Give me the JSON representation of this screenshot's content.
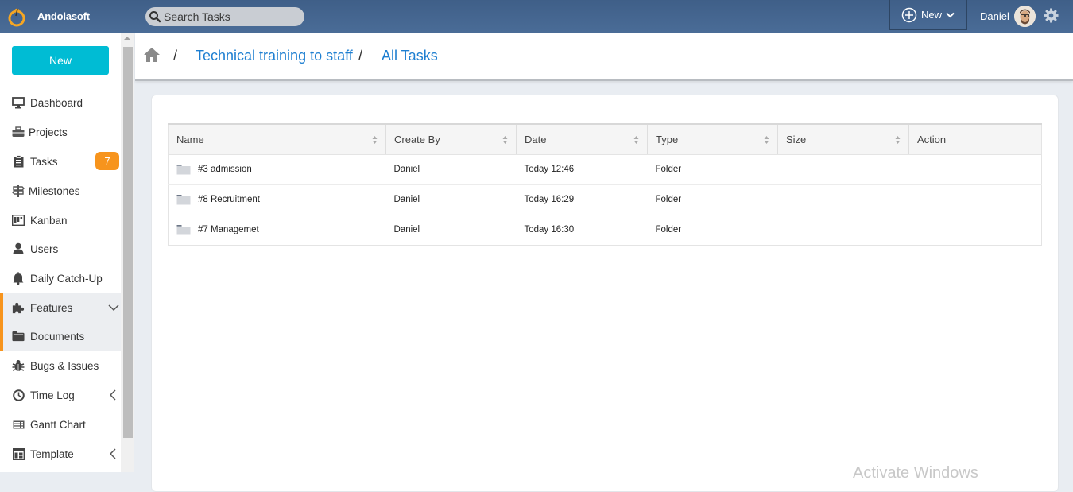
{
  "topbar": {
    "brand": "Andolasoft",
    "search_placeholder": "Search Tasks",
    "new_label": "New",
    "user_name": "Daniel"
  },
  "sidebar": {
    "new_button": "New",
    "items": [
      {
        "label": "Dashboard",
        "icon": "monitor-icon"
      },
      {
        "label": "Projects",
        "icon": "briefcase-icon"
      },
      {
        "label": "Tasks",
        "icon": "clipboard-icon",
        "badge": "7"
      },
      {
        "label": "Milestones",
        "icon": "signpost-icon"
      },
      {
        "label": "Kanban",
        "icon": "kanban-icon"
      },
      {
        "label": "Users",
        "icon": "user-icon"
      },
      {
        "label": "Daily Catch-Up",
        "icon": "bell-icon"
      },
      {
        "label": "Features",
        "icon": "puzzle-icon",
        "expanded": true
      },
      {
        "label": "Documents",
        "icon": "folder-icon",
        "active": true
      },
      {
        "label": "Bugs & Issues",
        "icon": "bug-icon"
      },
      {
        "label": "Time Log",
        "icon": "clock-icon"
      },
      {
        "label": "Gantt Chart",
        "icon": "gantt-icon"
      },
      {
        "label": "Template",
        "icon": "template-icon"
      }
    ]
  },
  "breadcrumb": {
    "separator": "/",
    "items": [
      "Technical training to staff",
      "All Tasks"
    ]
  },
  "table": {
    "columns": [
      "Name",
      "Create By",
      "Date",
      "Type",
      "Size",
      "Action"
    ],
    "rows": [
      {
        "name": "#3 admission",
        "created_by": "Daniel",
        "date": "Today 12:46",
        "type": "Folder",
        "size": "",
        "action": ""
      },
      {
        "name": "#8 Recruitment",
        "created_by": "Daniel",
        "date": "Today 16:29",
        "type": "Folder",
        "size": "",
        "action": ""
      },
      {
        "name": "#7 Managemet",
        "created_by": "Daniel",
        "date": "Today 16:30",
        "type": "Folder",
        "size": "",
        "action": ""
      }
    ]
  },
  "colors": {
    "topbar": "#4a6c97",
    "new_button": "#00bcd4",
    "accent_orange": "#f7941d",
    "link_blue": "#1e7fd1"
  },
  "watermark": "Activate Windows"
}
